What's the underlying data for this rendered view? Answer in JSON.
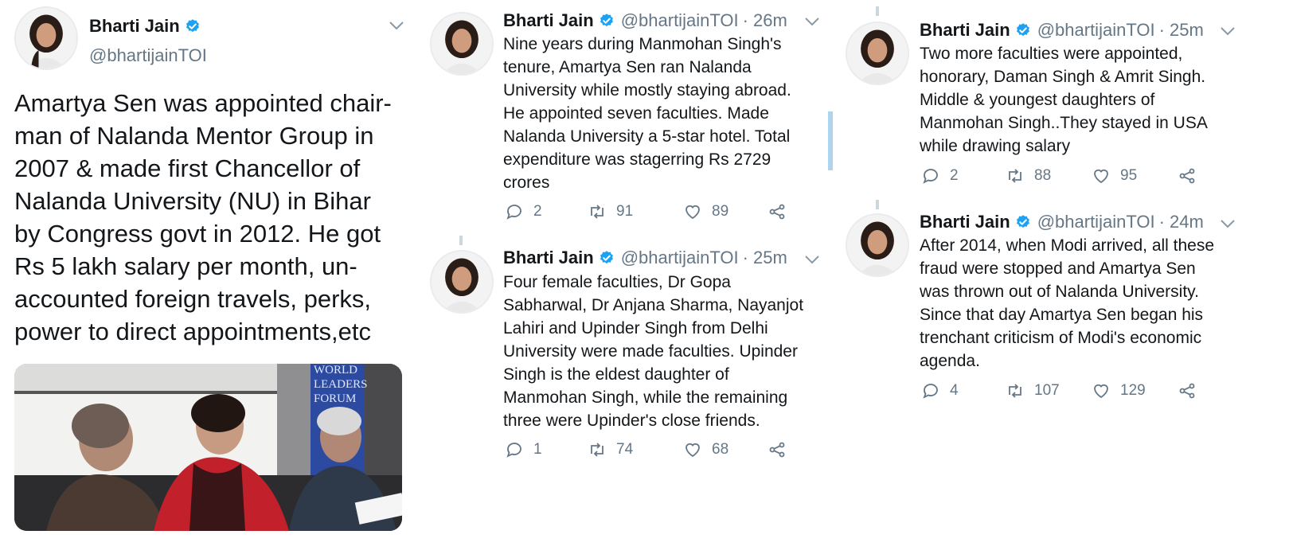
{
  "author": {
    "name": "Bharti Jain",
    "handle": "@bhartijainTOI",
    "verified_color": "#1da1f2"
  },
  "colors": {
    "text": "#14171a",
    "muted": "#657786",
    "accent": "#1da1f2"
  },
  "main_tweet": {
    "text_lines": [
      "Amartya Sen was appointed chair-",
      "man of Nalanda Mentor Group in",
      "2007 & made first Chancellor of",
      "Nalanda University (NU) in Bihar",
      "by Congress govt in 2012. He got",
      "Rs 5 lakh salary per month, un-",
      "accounted foreign travels, perks,",
      "power to direct appointments,etc"
    ],
    "photo_banner_text": [
      "WORLD",
      "LEADERS",
      "FORUM"
    ]
  },
  "tweets": [
    {
      "id": "t2",
      "time": "· 26m",
      "text_lines": [
        "Nine years during Manmohan Singh's",
        "tenure, Amartya Sen ran Nalanda",
        "University while mostly staying abroad.",
        "He appointed seven faculties. Made",
        "Nalanda University a 5-star hotel. Total",
        "expenditure was stagerring Rs 2729",
        "crores"
      ],
      "replies": "2",
      "retweets": "91",
      "likes": "89"
    },
    {
      "id": "t3",
      "time": "· 25m",
      "text_lines": [
        "Four female faculties, Dr Gopa",
        "Sabharwal, Dr Anjana Sharma, Nayanjot",
        "Lahiri and Upinder Singh from Delhi",
        "University were made faculties. Upinder",
        "Singh is the eldest daughter of",
        "Manmohan Singh, while the remaining",
        "three were Upinder's close friends."
      ],
      "replies": "1",
      "retweets": "74",
      "likes": "68"
    },
    {
      "id": "t4",
      "time": "· 25m",
      "text_lines": [
        "Two more faculties were appointed,",
        "honorary, Daman Singh & Amrit Singh.",
        "Middle & youngest daughters of",
        "Manmohan Singh..They stayed in USA",
        "while drawing salary"
      ],
      "replies": "2",
      "retweets": "88",
      "likes": "95"
    },
    {
      "id": "t5",
      "time": "· 24m",
      "text_lines": [
        "After 2014, when Modi arrived, all these",
        "fraud were stopped and Amartya Sen",
        "was thrown out of Nalanda University.",
        "Since that day Amartya Sen began his",
        "trenchant criticism of Modi's economic",
        "agenda."
      ],
      "replies": "4",
      "retweets": "107",
      "likes": "129"
    }
  ]
}
